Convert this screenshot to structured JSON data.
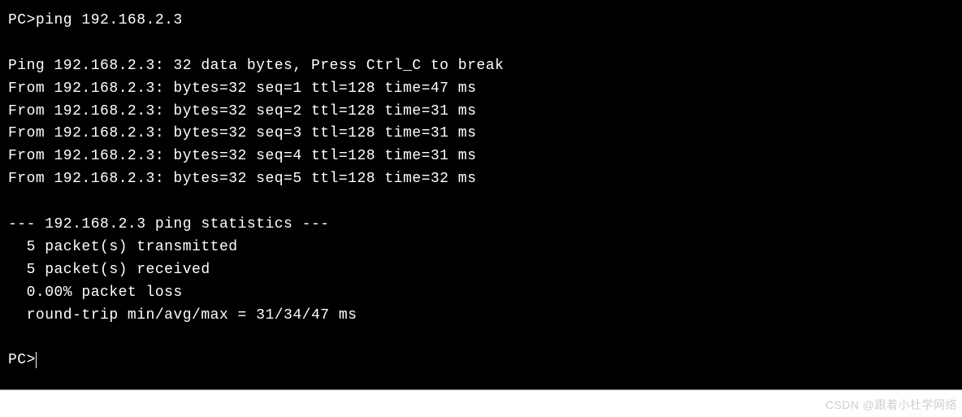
{
  "terminal": {
    "prompt1": "PC>",
    "command": "ping 192.168.2.3",
    "blank1": "",
    "header": "Ping 192.168.2.3: 32 data bytes, Press Ctrl_C to break",
    "replies": [
      "From 192.168.2.3: bytes=32 seq=1 ttl=128 time=47 ms",
      "From 192.168.2.3: bytes=32 seq=2 ttl=128 time=31 ms",
      "From 192.168.2.3: bytes=32 seq=3 ttl=128 time=31 ms",
      "From 192.168.2.3: bytes=32 seq=4 ttl=128 time=31 ms",
      "From 192.168.2.3: bytes=32 seq=5 ttl=128 time=32 ms"
    ],
    "blank2": "",
    "stats_header": "--- 192.168.2.3 ping statistics ---",
    "stats": [
      "  5 packet(s) transmitted",
      "  5 packet(s) received",
      "  0.00% packet loss",
      "  round-trip min/avg/max = 31/34/47 ms"
    ],
    "blank3": "",
    "prompt2": "PC>"
  },
  "watermark": "CSDN @跟着小杜学网络"
}
